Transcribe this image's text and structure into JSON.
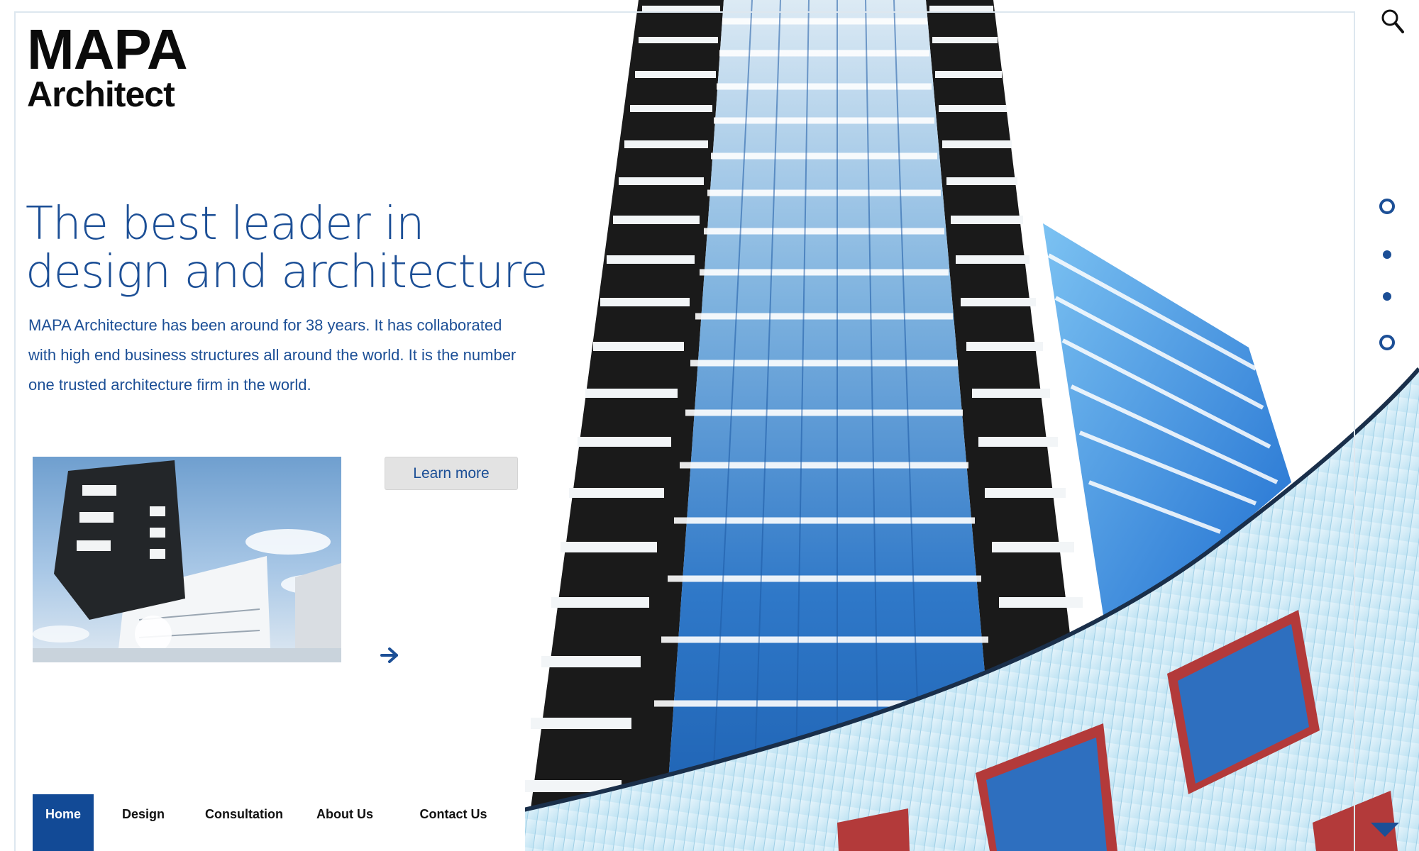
{
  "brand": {
    "line1": "MAPA",
    "line2": "Architect"
  },
  "hero": {
    "headline_line1": "The best leader in",
    "headline_line2": "design and architecture",
    "intro": "MAPA Architecture has been around for 38 years. It has collaborated with high end business structures all around  the world. It is the number one trusted architecture firm in the world."
  },
  "cta": {
    "learn_more": "Learn more"
  },
  "nav": {
    "items": [
      {
        "label": "Home",
        "active": true
      },
      {
        "label": "Design",
        "active": false
      },
      {
        "label": "Consultation",
        "active": false
      },
      {
        "label": "About Us",
        "active": false
      },
      {
        "label": "Contact Us",
        "active": false
      }
    ]
  },
  "slider": {
    "count": 4,
    "styles": [
      "ring",
      "fill",
      "fill",
      "ring"
    ]
  },
  "icons": {
    "search": "search-icon",
    "next": "arrow-right-icon",
    "scroll_down": "triangle-down-icon"
  },
  "colors": {
    "accent": "#1c4f96",
    "nav_active_bg": "#124a96",
    "button_bg": "#e3e3e3",
    "text_dark": "#0b0b0b"
  }
}
